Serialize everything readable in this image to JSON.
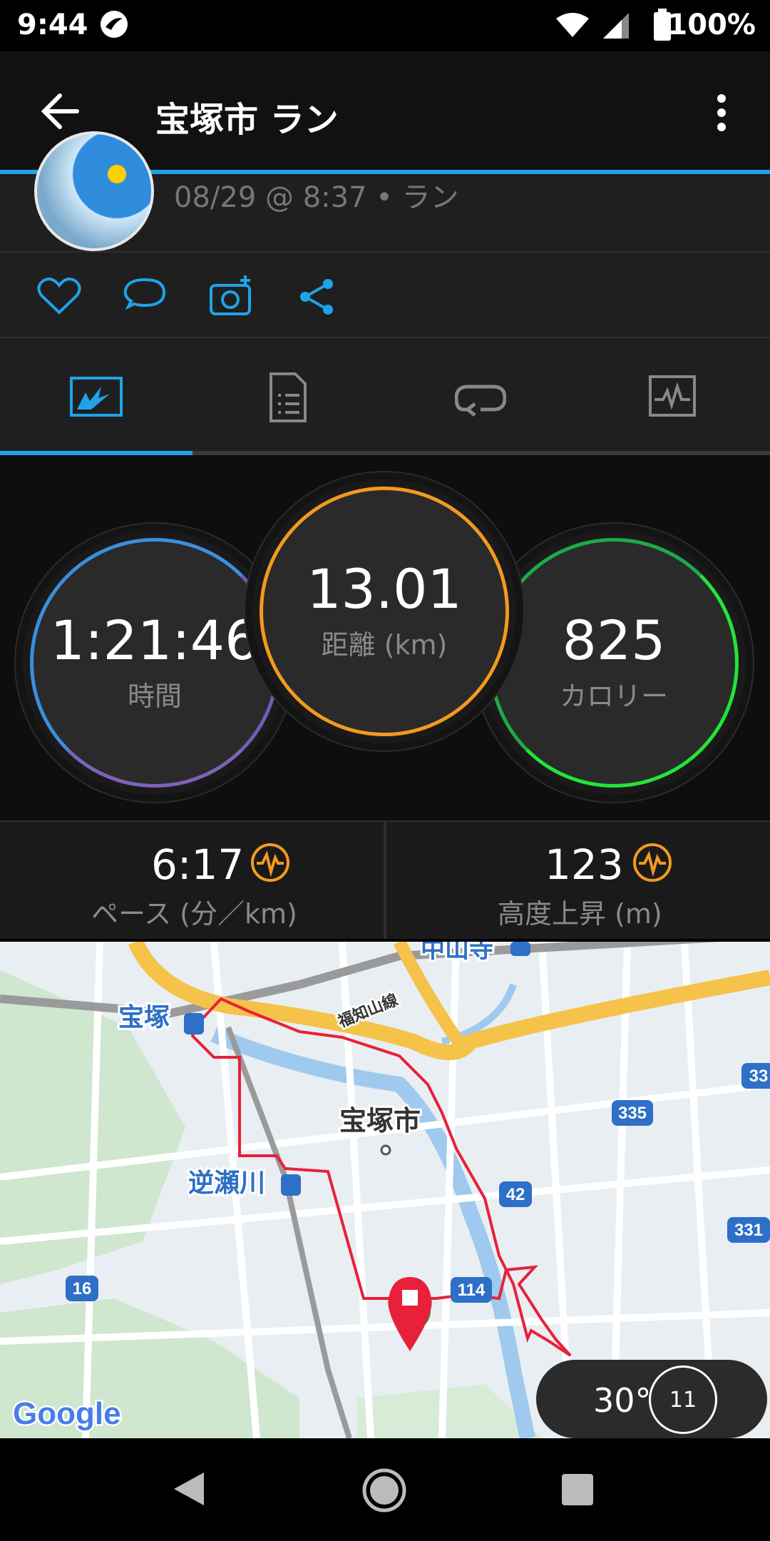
{
  "status_bar": {
    "time": "9:44",
    "battery": "100%"
  },
  "app_bar": {
    "title": "宝塚市 ラン"
  },
  "header": {
    "meta": "08/29 @ 8:37 • ラン"
  },
  "stats": {
    "time": {
      "value": "1:21:46",
      "label": "時間"
    },
    "distance": {
      "value": "13.01",
      "label": "距離 (km)"
    },
    "calories": {
      "value": "825",
      "label": "カロリー"
    }
  },
  "summary": {
    "pace": {
      "value": "6:17",
      "label": "ペース (分／km)"
    },
    "ascent": {
      "value": "123",
      "label": "高度上昇 (m)"
    }
  },
  "map": {
    "labels": {
      "nakayamadera": "中山寺",
      "takarazuka": "宝塚",
      "line": "福知山線",
      "city": "宝塚市",
      "sakasegawa": "逆瀬川"
    },
    "route_numbers": [
      "335",
      "42",
      "331",
      "16",
      "114",
      "33"
    ],
    "google": "Google",
    "weather": {
      "temp": "30°",
      "wind": "11"
    }
  },
  "colors": {
    "accent": "#1fa3e8",
    "time_ring": "#3a7fd6",
    "distance_ring": "#f39a1f",
    "calorie_ring": "#1fd63a",
    "route": "#e8203a"
  }
}
